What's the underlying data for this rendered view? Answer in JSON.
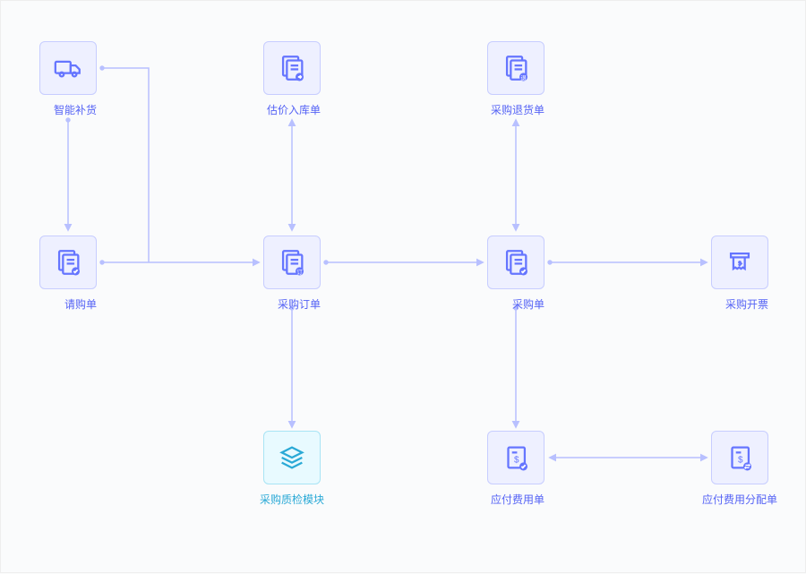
{
  "nodes": {
    "smart_restock": {
      "label": "智能补货",
      "icon": "truck-icon"
    },
    "purchase_request": {
      "label": "请购单",
      "icon": "document-check-icon"
    },
    "estimate_inbound": {
      "label": "估价入库单",
      "icon": "document-arrow-icon"
    },
    "purchase_order": {
      "label": "采购订单",
      "icon": "document-order-icon"
    },
    "purchase_qc": {
      "label": "采购质检模块",
      "icon": "stack-icon"
    },
    "purchase_return": {
      "label": "采购退货单",
      "icon": "document-return-icon"
    },
    "purchase_slip": {
      "label": "采购单",
      "icon": "document-check-icon"
    },
    "payable_expense": {
      "label": "应付费用单",
      "icon": "document-money-icon"
    },
    "purchase_invoice": {
      "label": "采购开票",
      "icon": "invoice-icon"
    },
    "payable_alloc": {
      "label": "应付费用分配单",
      "icon": "document-swap-icon"
    }
  },
  "colors": {
    "primary": "#6575ff",
    "cyan": "#2aa9d6",
    "arrow": "#b8c0ff"
  }
}
